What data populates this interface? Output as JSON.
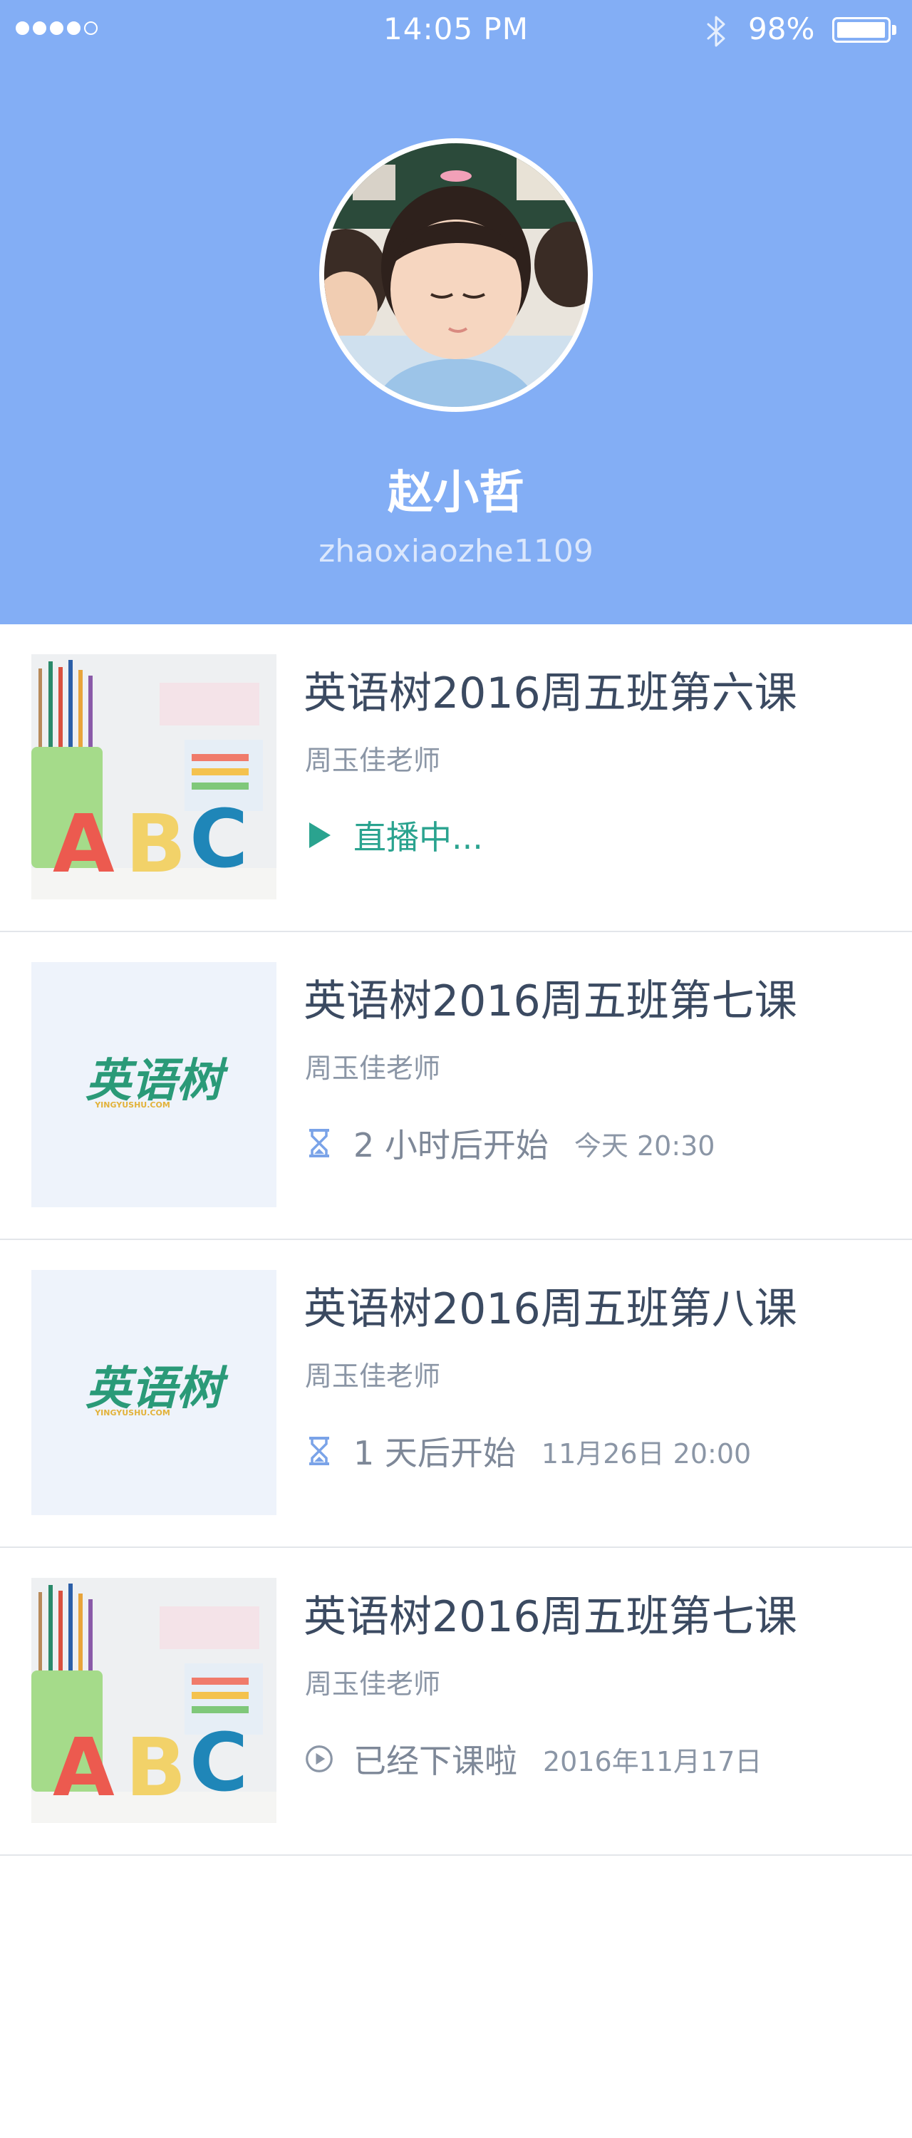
{
  "status_bar": {
    "signal_dots_filled": 4,
    "signal_dots_total": 5,
    "time": "14:05 PM",
    "battery_percent": "98%",
    "battery_level": 0.98
  },
  "profile": {
    "name": "赵小哲",
    "username": "zhaoxiaozhe1109"
  },
  "colors": {
    "header_bg": "#83aef5",
    "live": "#2aa38f",
    "upcoming_icon": "#7aa3e8",
    "divider": "#e3e6ea"
  },
  "courses": [
    {
      "title": "英语树2016周五班第六课",
      "teacher": "周玉佳老师",
      "status": "直播中...",
      "time": "",
      "status_icon": "play-icon",
      "thumbnail": "abc-blocks-image"
    },
    {
      "title": "英语树2016周五班第七课",
      "teacher": "周玉佳老师",
      "status": "2 小时后开始",
      "time": "今天 20:30",
      "status_icon": "hourglass-icon",
      "thumbnail": "yingyushu-logo",
      "logo_text": "英语树",
      "logo_sub": "YINGYUSHU.COM"
    },
    {
      "title": "英语树2016周五班第八课",
      "teacher": "周玉佳老师",
      "status": "1 天后开始",
      "time": "11月26日 20:00",
      "status_icon": "hourglass-icon",
      "thumbnail": "yingyushu-logo",
      "logo_text": "英语树",
      "logo_sub": "YINGYUSHU.COM"
    },
    {
      "title": "英语树2016周五班第七课",
      "teacher": "周玉佳老师",
      "status": "已经下课啦",
      "time": "2016年11月17日",
      "status_icon": "replay-circle-icon",
      "thumbnail": "abc-blocks-image"
    }
  ]
}
